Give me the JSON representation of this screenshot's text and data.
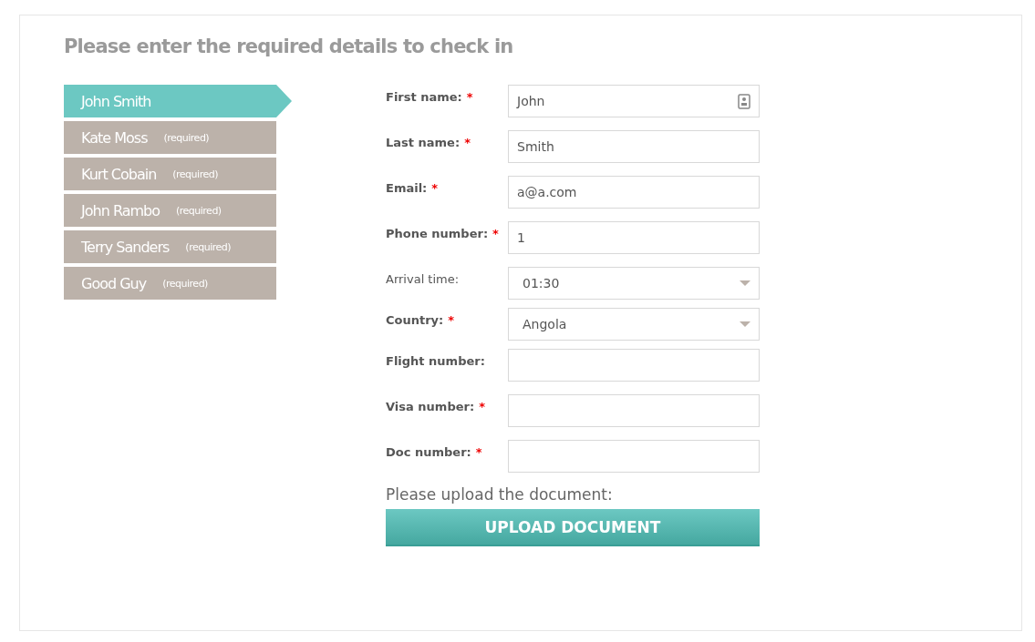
{
  "title": "Please enter the required details to check in",
  "guests": [
    {
      "name": "John Smith",
      "selected": true
    },
    {
      "name": "Kate Moss",
      "note": "(required)",
      "selected": false
    },
    {
      "name": "Kurt Cobain",
      "note": "(required)",
      "selected": false
    },
    {
      "name": "John Rambo",
      "note": "(required)",
      "selected": false
    },
    {
      "name": "Terry Sanders",
      "note": "(required)",
      "selected": false
    },
    {
      "name": "Good Guy",
      "note": "(required)",
      "selected": false
    }
  ],
  "fields": [
    {
      "kind": "text",
      "label": "First name:",
      "marker": "*",
      "bold": true,
      "value": "John",
      "contact_icon": true
    },
    {
      "kind": "text",
      "label": "Last name:",
      "marker": "*",
      "bold": true,
      "value": "Smith"
    },
    {
      "kind": "text",
      "label": "Email:",
      "marker": "*",
      "bold": true,
      "value": "a@a.com"
    },
    {
      "kind": "text",
      "label": "Phone number:",
      "marker": "*",
      "bold": true,
      "value": "1"
    },
    {
      "kind": "select",
      "label": "Arrival time:",
      "bold": false,
      "value": "01:30"
    },
    {
      "kind": "select",
      "label": "Country:",
      "marker": "*",
      "bold": true,
      "value": "Angola"
    },
    {
      "kind": "text",
      "label": "Flight number:",
      "bold": true
    },
    {
      "kind": "text",
      "label": "Visa number:",
      "marker": "*",
      "bold": true
    },
    {
      "kind": "text",
      "label": "Doc number:",
      "marker": "*",
      "bold": true
    }
  ],
  "upload": {
    "prompt": "Please upload the document:",
    "button": "UPLOAD DOCUMENT"
  }
}
